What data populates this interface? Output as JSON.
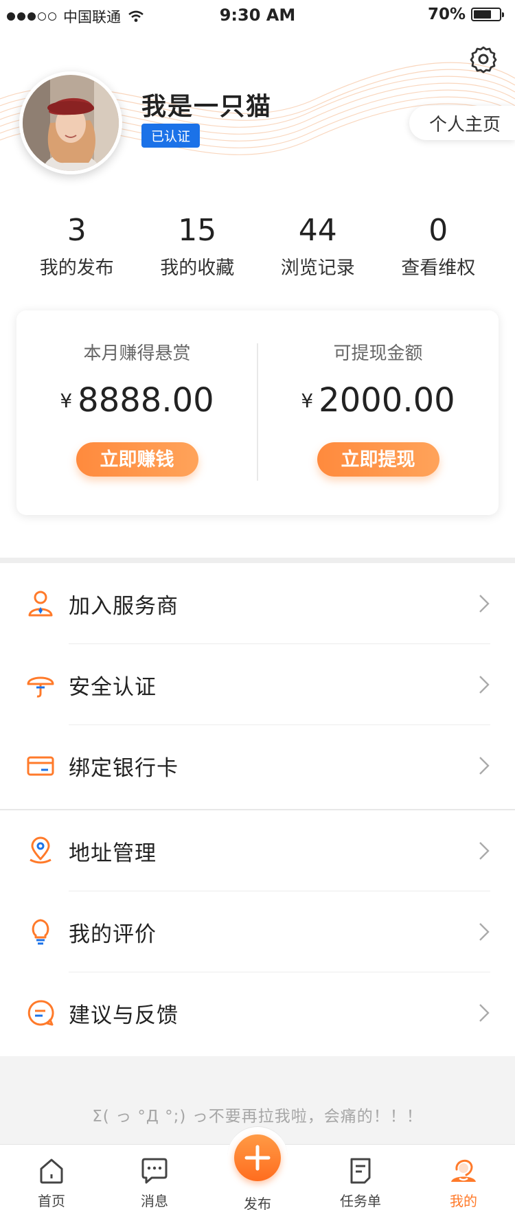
{
  "status_bar": {
    "carrier": "中国联通",
    "time": "9:30 AM",
    "battery": "70%",
    "battery_level": 0.7,
    "signal_bars": 3
  },
  "header": {
    "username": "我是一只猫",
    "verified_badge": "已认证",
    "homepage_button": "个人主页",
    "settings_icon": "gear-icon"
  },
  "stats": [
    {
      "value": "3",
      "label": "我的发布"
    },
    {
      "value": "15",
      "label": "我的收藏"
    },
    {
      "value": "44",
      "label": "浏览记录"
    },
    {
      "value": "0",
      "label": "查看维权"
    }
  ],
  "earnings": {
    "currency": "¥",
    "monthly": {
      "title": "本月赚得悬赏",
      "amount": "8888.00",
      "button": "立即赚钱"
    },
    "withdrawable": {
      "title": "可提现金额",
      "amount": "2000.00",
      "button": "立即提现"
    }
  },
  "menu_group_1": [
    {
      "label": "加入服务商",
      "icon": "person-badge-icon"
    },
    {
      "label": "安全认证",
      "icon": "umbrella-icon"
    },
    {
      "label": "绑定银行卡",
      "icon": "bank-card-icon"
    }
  ],
  "menu_group_2": [
    {
      "label": "地址管理",
      "icon": "location-pin-icon"
    },
    {
      "label": "我的评价",
      "icon": "lightbulb-icon"
    },
    {
      "label": "建议与反馈",
      "icon": "feedback-bubble-icon"
    }
  ],
  "footer_tip": "Σ( っ °Д °;) っ不要再拉我啦，会痛的！！！",
  "tabbar": {
    "tabs": [
      {
        "label": "首页",
        "icon": "home-icon"
      },
      {
        "label": "消息",
        "icon": "message-icon"
      },
      {
        "label": "发布",
        "icon": "plus-icon"
      },
      {
        "label": "任务单",
        "icon": "task-list-icon"
      },
      {
        "label": "我的",
        "icon": "profile-icon"
      }
    ],
    "active_index": 4
  },
  "colors": {
    "accent": "#ff7a2a",
    "badge_blue": "#1b72e8",
    "icon_blue": "#1b72e8"
  }
}
